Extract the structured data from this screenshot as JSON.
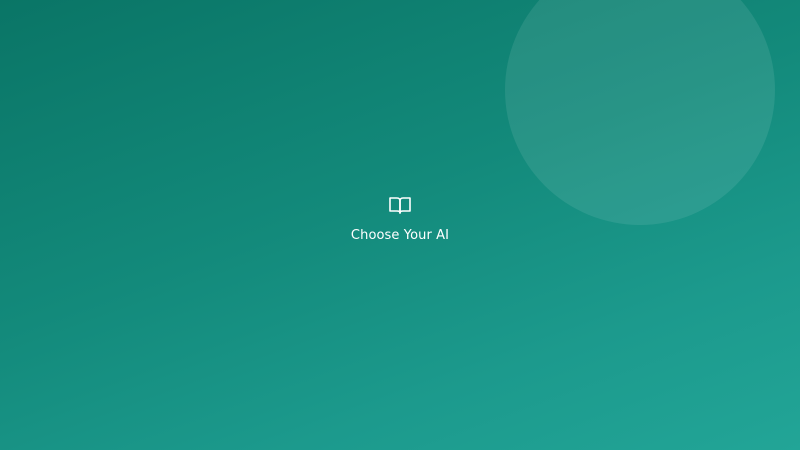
{
  "splash": {
    "title": "Choose Your AI",
    "icon": "book-icon"
  },
  "colors": {
    "background_start": "#0a7566",
    "background_end": "#22a597",
    "text": "#ffffff"
  }
}
